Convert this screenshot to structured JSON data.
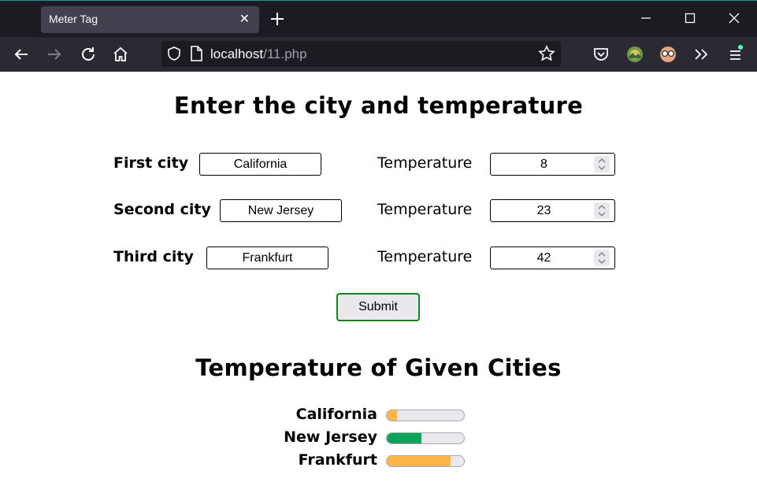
{
  "browser": {
    "tab_title": "Meter Tag",
    "tab_close_glyph": "✕",
    "url_host": "localhost",
    "url_path": "/11.php"
  },
  "page": {
    "heading": "Enter the city and temperature",
    "temperature_label": "Temperature",
    "rows": [
      {
        "label": "First city",
        "city": "California",
        "temperature": "8"
      },
      {
        "label": "Second city",
        "city": "New Jersey",
        "temperature": "23"
      },
      {
        "label": "Third city",
        "city": "Frankfurt",
        "temperature": "42"
      }
    ],
    "submit_label": "Submit",
    "results_heading": "Temperature of Given Cities",
    "meters": [
      {
        "city": "California",
        "level": 0.13,
        "color": "#ffb545"
      },
      {
        "city": "New Jersey",
        "level": 0.45,
        "color": "#0aa35a"
      },
      {
        "city": "Frankfurt",
        "level": 0.83,
        "color": "#ffb545"
      }
    ]
  },
  "colors": {
    "tabbar_bg": "#1c1b22",
    "navbar_bg": "#2b2a33",
    "submit_border": "#0b8a1a",
    "meter_low_high": "#ffb545",
    "meter_optimum": "#0aa35a"
  }
}
